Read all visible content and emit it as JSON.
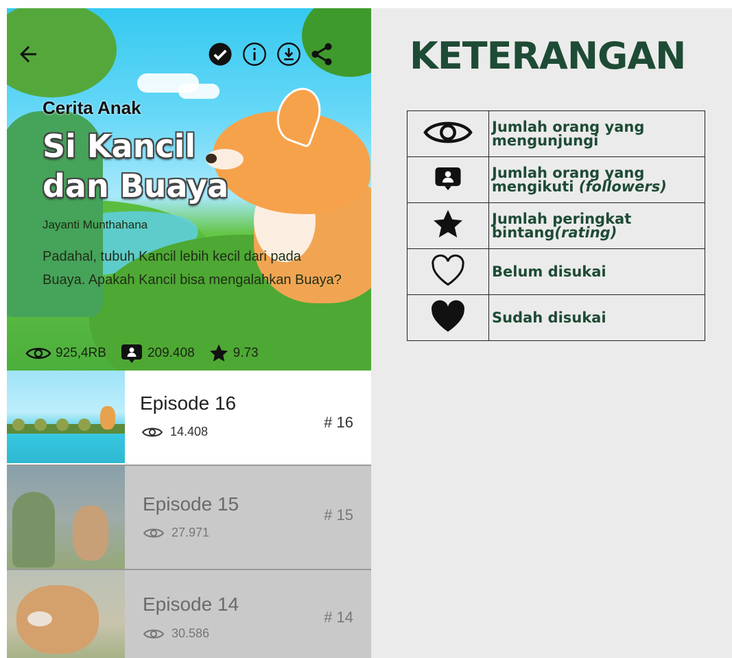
{
  "app": {
    "header_icons": [
      "back-arrow-icon",
      "check-circle-icon",
      "info-icon",
      "download-icon",
      "share-icon"
    ],
    "category": "Cerita Anak",
    "title": "Si Kancil dan Buaya",
    "author": "Jayanti Munthahana",
    "synopsis": "Padahal, tubuh Kancil lebih kecil dari pada Buaya. Apakah Kancil bisa mengalahkan Buaya?",
    "stats": {
      "views": "925,4RB",
      "followers": "209.408",
      "rating": "9.73"
    },
    "episodes": [
      {
        "title": "Episode 16",
        "views": "14.408",
        "number": "# 16",
        "state": "active"
      },
      {
        "title": "Episode 15",
        "views": "27.971",
        "number": "# 15",
        "state": "locked"
      },
      {
        "title": "Episode 14",
        "views": "30.586",
        "number": "# 14",
        "state": "locked"
      }
    ]
  },
  "legend": {
    "title": "KETERANGAN",
    "rows": [
      {
        "icon": "eye-icon",
        "text": "Jumlah orang yang mengunjungi"
      },
      {
        "icon": "follower-icon",
        "text": "Jumlah orang yang mengikuti",
        "text_italic": "(followers)"
      },
      {
        "icon": "star-icon",
        "text": "Jumlah peringkat bintang",
        "text_italic": "(rating)"
      },
      {
        "icon": "heart-outline-icon",
        "text": "Belum disukai"
      },
      {
        "icon": "heart-filled-icon",
        "text": "Sudah disukai"
      }
    ]
  },
  "colors": {
    "legend_text": "#1e4b35",
    "panel_bg": "#ebebeb",
    "episode_active_bg": "#ffffff",
    "episode_locked_bg": "#c9c9c9"
  }
}
